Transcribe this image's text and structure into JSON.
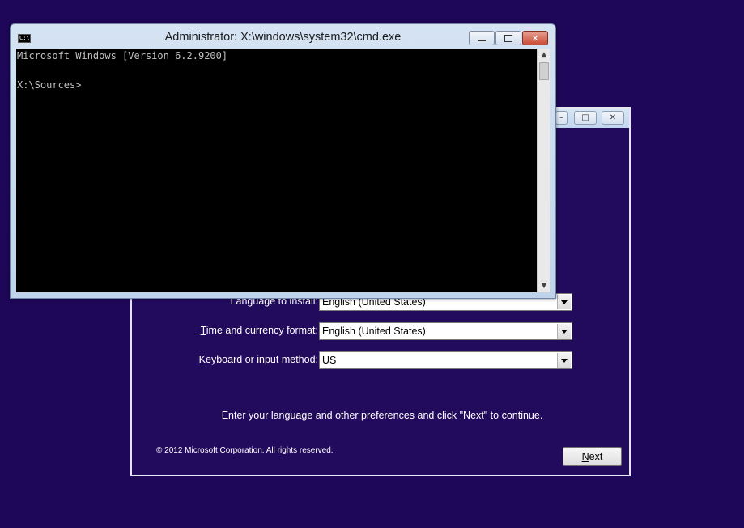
{
  "cmd": {
    "title": "Administrator: X:\\windows\\system32\\cmd.exe",
    "icon_label": "C:\\",
    "lines": [
      "Microsoft Windows [Version 6.2.9200]",
      "",
      "X:\\Sources>"
    ],
    "buttons": {
      "minimize": "minimize",
      "maximize": "maximize",
      "close": "✕"
    }
  },
  "setup": {
    "title_buttons": {
      "minimize": "–",
      "maximize": "□",
      "close": "✕"
    },
    "fields": [
      {
        "label_pre": "Langua",
        "label_u": "g",
        "label_post": "e to install:",
        "value": "English (United States)"
      },
      {
        "label_pre": "",
        "label_u": "T",
        "label_post": "ime and currency format:",
        "value": "English (United States)"
      },
      {
        "label_pre": "",
        "label_u": "K",
        "label_post": "eyboard or input method:",
        "value": "US"
      }
    ],
    "instruction": "Enter your language and other preferences and click \"Next\" to continue.",
    "copyright": "© 2012 Microsoft Corporation. All rights reserved.",
    "next_u": "N",
    "next_rest": "ext"
  }
}
